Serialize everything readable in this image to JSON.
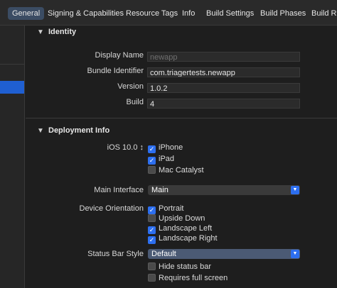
{
  "tabs": [
    {
      "label": "General",
      "selected": true
    },
    {
      "label": "Signing & Capabilities"
    },
    {
      "label": "Resource Tags"
    },
    {
      "label": "Info"
    },
    {
      "label": "Build Settings"
    },
    {
      "label": "Build Phases"
    },
    {
      "label": "Build Ru"
    }
  ],
  "identity": {
    "header": "Identity",
    "display_name": {
      "label": "Display Name",
      "placeholder": "newapp"
    },
    "bundle_identifier": {
      "label": "Bundle Identifier",
      "value": "com.triagertests.newapp"
    },
    "version": {
      "label": "Version",
      "value": "1.0.2"
    },
    "build": {
      "label": "Build",
      "value": "4"
    }
  },
  "deployment": {
    "header": "Deployment Info",
    "ios_target": "iOS 10.0 ↕",
    "devices": [
      {
        "label": "iPhone",
        "checked": true
      },
      {
        "label": "iPad",
        "checked": true
      },
      {
        "label": "Mac Catalyst",
        "checked": false
      }
    ],
    "main_interface": {
      "label": "Main Interface",
      "value": "Main"
    },
    "device_orientation": {
      "label": "Device Orientation",
      "options": [
        {
          "label": "Portrait",
          "checked": true
        },
        {
          "label": "Upside Down",
          "checked": false
        },
        {
          "label": "Landscape Left",
          "checked": true
        },
        {
          "label": "Landscape Right",
          "checked": true
        }
      ]
    },
    "status_bar_style": {
      "label": "Status Bar Style",
      "value": "Default"
    },
    "status_bar_options": [
      {
        "label": "Hide status bar",
        "checked": false
      },
      {
        "label": "Requires full screen",
        "checked": false
      }
    ]
  },
  "icons": {
    "checkmark": "✓",
    "chevron": "▼",
    "dropdown": "▼"
  },
  "colors": {
    "accent": "#2d6ff0",
    "selected_tab": "#3b4c63",
    "background": "#1e1e1e"
  }
}
